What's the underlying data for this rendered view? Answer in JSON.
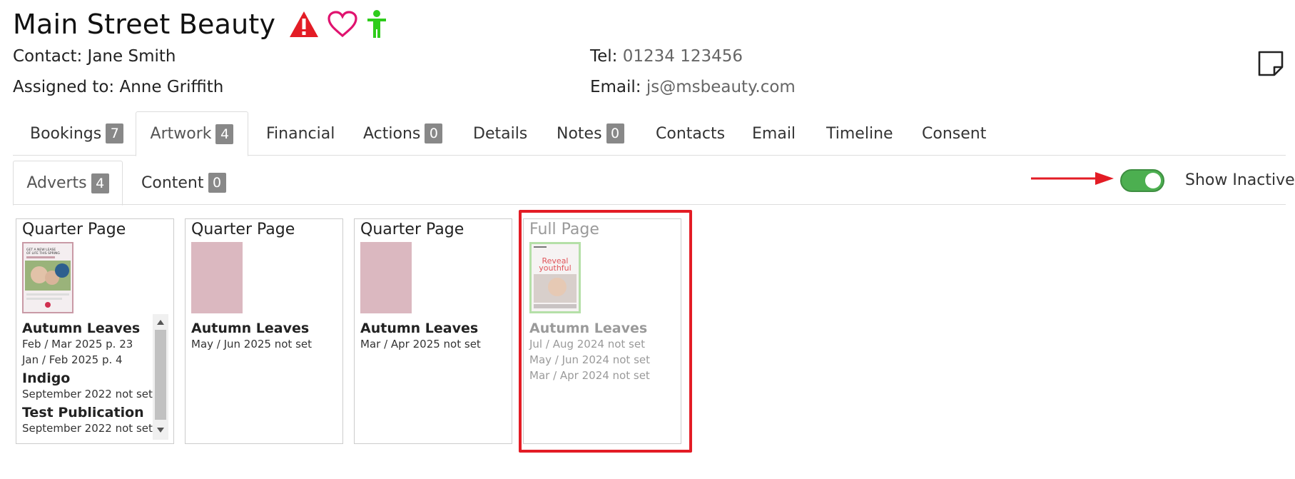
{
  "header": {
    "title": "Main Street Beauty",
    "icons": [
      "warning-icon",
      "heart-icon",
      "person-icon"
    ],
    "contact_label": "Contact:",
    "contact_value": "Jane Smith",
    "assigned_label": "Assigned to:",
    "assigned_value": "Anne Griffith",
    "tel_label": "Tel:",
    "tel_value": "01234 123456",
    "email_label": "Email:",
    "email_value": "js@msbeauty.com"
  },
  "tabs": [
    {
      "label": "Bookings",
      "badge": "7"
    },
    {
      "label": "Artwork",
      "badge": "4",
      "active": true
    },
    {
      "label": "Financial"
    },
    {
      "label": "Actions",
      "badge": "0"
    },
    {
      "label": "Details"
    },
    {
      "label": "Notes",
      "badge": "0"
    },
    {
      "label": "Contacts"
    },
    {
      "label": "Email"
    },
    {
      "label": "Timeline"
    },
    {
      "label": "Consent"
    }
  ],
  "subtabs": [
    {
      "label": "Adverts",
      "badge": "4",
      "active": true
    },
    {
      "label": "Content",
      "badge": "0"
    }
  ],
  "show_inactive": {
    "label": "Show Inactive",
    "on": true
  },
  "cards": [
    {
      "title": "Quarter Page",
      "pubs": [
        {
          "name": "Autumn Leaves",
          "lines": [
            "Feb / Mar 2025 p. 23",
            "Jan / Feb 2025 p. 4"
          ]
        },
        {
          "name": "Indigo",
          "lines": [
            "September 2022 not set"
          ]
        },
        {
          "name": "Test Publication",
          "lines": [
            "September 2022 not set"
          ]
        }
      ],
      "thumb_text": [
        "GET A NEW LEASE",
        "OF LIFE THIS SPRING"
      ]
    },
    {
      "title": "Quarter Page",
      "pubs": [
        {
          "name": "Autumn Leaves",
          "lines": [
            "May / Jun 2025 not set"
          ]
        }
      ]
    },
    {
      "title": "Quarter Page",
      "pubs": [
        {
          "name": "Autumn Leaves",
          "lines": [
            "Mar / Apr 2025 not set"
          ]
        }
      ]
    },
    {
      "title": "Full Page",
      "inactive": true,
      "pubs": [
        {
          "name": "Autumn Leaves",
          "lines": [
            "Jul / Aug 2024 not set",
            "May / Jun 2024 not set",
            "Mar / Apr 2024 not set"
          ]
        }
      ],
      "thumb_text": [
        "Reveal",
        "youthful"
      ]
    }
  ],
  "colors": {
    "accent_toggle": "#4caf50",
    "highlight": "#e31c25",
    "warning": "#e31c25",
    "heart": "#e0136f",
    "person": "#2ecc1b",
    "thumb_pink": "#dbb8c0"
  }
}
